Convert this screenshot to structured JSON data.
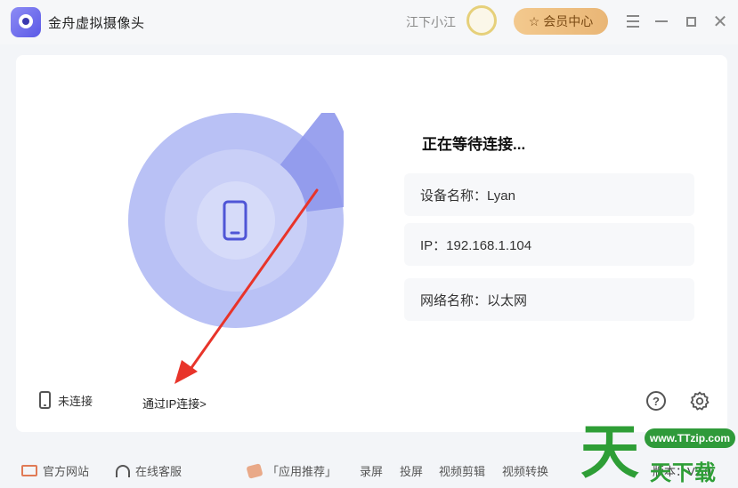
{
  "window": {
    "title": "金舟虚拟摄像头",
    "username": "江下小江",
    "vip_label": "会员中心"
  },
  "status": {
    "title": "正在等待连接..."
  },
  "info": {
    "device_name": "设备名称：Lyan",
    "ip": "IP：192.168.1.104",
    "network_name": "网络名称：以太网"
  },
  "connection": {
    "state_label": "未连接",
    "ip_link": "通过IP连接>"
  },
  "footer": {
    "site": "官方网站",
    "service": "在线客服",
    "apps": "「应用推荐」",
    "record": "录屏",
    "cast": "投屏",
    "video_edit": "视频剪辑",
    "video_convert": "视频转换",
    "version": "版本：V2.0"
  },
  "watermark": {
    "big_char": "天",
    "url": "www.TTzip.com",
    "sub": "天下载"
  },
  "colors": {
    "accent": "#6b6de8",
    "vip_gold": "#e9b676",
    "annotation_arrow": "#e8342a"
  }
}
